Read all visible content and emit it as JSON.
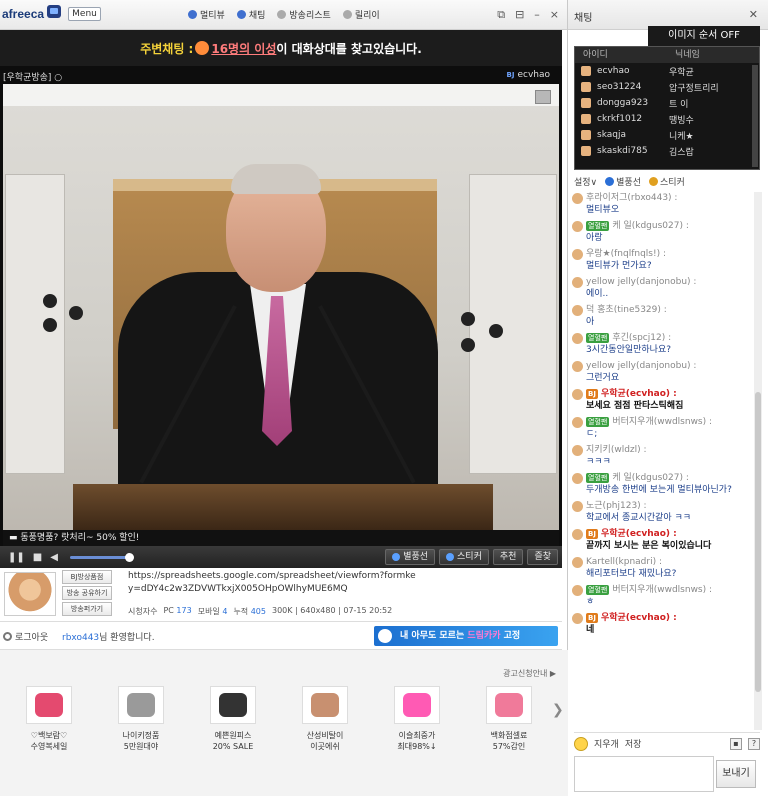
{
  "app": {
    "logo": "afreeca",
    "menu_label": "Menu"
  },
  "top_links": [
    "멀티뷰",
    "채팅",
    "방송리스트",
    "릴리이"
  ],
  "window_controls": [
    "⧉",
    "⊟",
    "–",
    "×"
  ],
  "notice": {
    "prefix": "주변채팅 :",
    "viewers": "16명의 이성",
    "suffix": "이 대화상대를 찾고있습니다."
  },
  "stream": {
    "channel": "[우학균방송] ○",
    "bj": "ecvhao",
    "bj_prefix": "BJ"
  },
  "ticker": "▬ 동풍명품? 랏처리~ 50% 할인!",
  "controls": {
    "buttons": [
      "별풍선",
      "스티커",
      "추천",
      "즐찾"
    ]
  },
  "info": {
    "mini_buttons": [
      "BJ방상품점",
      "방송 공유하기",
      "방송퍼가기"
    ],
    "url": "https://spreadsheets.google.com/spreadsheet/viewform?formkey=dDY4c2w3ZDVWTkxjX005OHpOWlhyMUE6MQ",
    "stats": {
      "viewer_label": "시청자수",
      "pc_label": "PC",
      "pc": "173",
      "mobile_label": "모바일",
      "mobile": "4",
      "total_label": "누적",
      "total": "405",
      "detail": "300K | 640x480 | 07-15 20:52"
    }
  },
  "greet": {
    "logout": "로그아웃",
    "user": "rbxo443",
    "text": "님 환영합니다."
  },
  "banner": {
    "prefix": "내 아무도 모르는",
    "highlight": "드림카카",
    "suffix": "고정"
  },
  "ads": {
    "title": "광고신청안내 ▶",
    "items": [
      {
        "line1": "♡백보람♡",
        "line2": "수영복세일",
        "color": "#e44a6f"
      },
      {
        "line1": "나이키정품",
        "line2": "5만원대야",
        "color": "#888888"
      },
      {
        "line1": "예쁜원피스",
        "line2": "20% SALE",
        "color": "#333333"
      },
      {
        "line1": "산성비탈이",
        "line2": "이곳에쉬",
        "color": "#c89070"
      },
      {
        "line1": "이슬최중가",
        "line2": "최대98%↓",
        "color": "#ff5ab4"
      },
      {
        "line1": "백화점셀료",
        "line2": "57%감인",
        "color": "#f07a9a"
      }
    ]
  },
  "chat": {
    "title": "채팅",
    "img_order": "이미지 순서 OFF",
    "user_headers": [
      "아이디",
      "닉네임"
    ],
    "users": [
      {
        "id": "ecvhao",
        "nick": "우학균"
      },
      {
        "id": "seo31224",
        "nick": "압구정트리리"
      },
      {
        "id": "dongga923",
        "nick": "트 이"
      },
      {
        "id": "ckrkf1012",
        "nick": "땡빙수"
      },
      {
        "id": "skaqja",
        "nick": "니케★"
      },
      {
        "id": "skaskdi785",
        "nick": "김스랍"
      }
    ],
    "tools": [
      "설정∨",
      "별풍선",
      "스티커"
    ],
    "messages": [
      {
        "who": "후라이저그(rbxo443) :",
        "text": "멀티뷰오",
        "tag": "",
        "bj": false
      },
      {
        "who": "케 일(kdgus027) :",
        "text": "아랑",
        "tag": "열혈팬",
        "bj": false
      },
      {
        "who": "우랑★(fnqlfnqls!) :",
        "text": "멀티뷰가 먼가요?",
        "tag": "",
        "bj": false
      },
      {
        "who": "yellow jelly(danjonobu) :",
        "text": "에이..",
        "tag": "",
        "bj": false
      },
      {
        "who": "덕 홍초(tine5329) :",
        "text": "아",
        "tag": "",
        "bj": false
      },
      {
        "who": "후긴(spcj12) :",
        "text": "3시간동안일만하나요?",
        "tag": "열혈팬",
        "bj": false
      },
      {
        "who": "yellow jelly(danjonobu) :",
        "text": "그런거요",
        "tag": "",
        "bj": false
      },
      {
        "who": "우학균(ecvhao) :",
        "text": "보세요 점점 판타스틱해짐",
        "tag": "BJ",
        "bj": true
      },
      {
        "who": "버터지우개(wwdlsnws) :",
        "text": "ㄷ;",
        "tag": "열혈팬",
        "bj": false
      },
      {
        "who": "지키키(wldzl) :",
        "text": "ㅋㅋㅋ",
        "tag": "",
        "bj": false
      },
      {
        "who": "케 일(kdgus027) :",
        "text": "두개방송 한번에 보는게 멀티뷰아닌가?",
        "tag": "열혈팬",
        "bj": false
      },
      {
        "who": "노근(phj123) :",
        "text": "학교에서 종교시간같아 ㅋㅋ",
        "tag": "",
        "bj": false
      },
      {
        "who": "우학균(ecvhao) :",
        "text": "끝까지 보시는 분은 복이있습니다",
        "tag": "BJ",
        "bj": true
      },
      {
        "who": "Kartell(kpnadri) :",
        "text": "해리포터보다 재밌나요?",
        "tag": "",
        "bj": false
      },
      {
        "who": "버터지우개(wwdlsnws) :",
        "text": "ㅎ",
        "tag": "열혈팬",
        "bj": false
      },
      {
        "who": "우학균(ecvhao) :",
        "text": "네",
        "tag": "BJ",
        "bj": true
      }
    ],
    "bottom": {
      "clear": "지우개",
      "save": "저장",
      "help": "?"
    },
    "send": "보내기"
  }
}
